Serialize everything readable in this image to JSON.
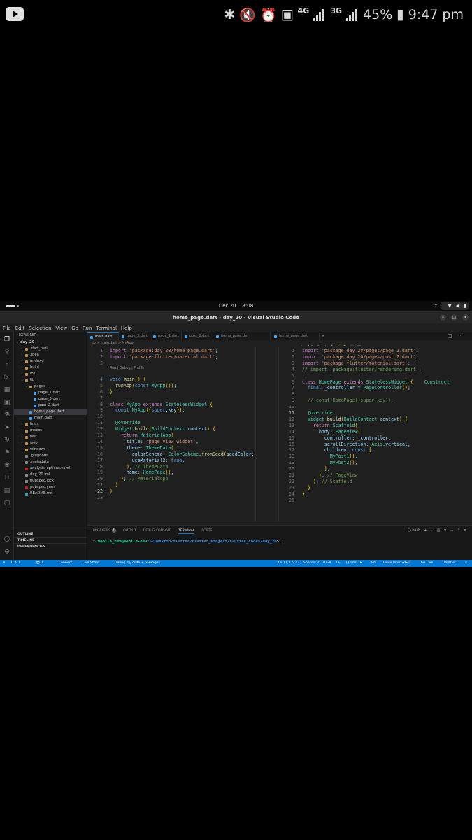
{
  "phone": {
    "battery": "45%",
    "time": "9:47 pm",
    "net1": "4G",
    "net2": "3G"
  },
  "topbar": {
    "date": "Dec 20",
    "time": "18:08"
  },
  "window": {
    "title": "home_page.dart - day_20 - Visual Studio Code"
  },
  "menu": [
    "File",
    "Edit",
    "Selection",
    "View",
    "Go",
    "Run",
    "Terminal",
    "Help"
  ],
  "explorer": {
    "header": "EXPLORER",
    "root": "day_20",
    "items": [
      {
        "label": ".dart_tool",
        "depth": 1,
        "type": "folder"
      },
      {
        "label": ".idea",
        "depth": 1,
        "type": "folder"
      },
      {
        "label": "android",
        "depth": 1,
        "type": "folder"
      },
      {
        "label": "build",
        "depth": 1,
        "type": "folder"
      },
      {
        "label": "ios",
        "depth": 1,
        "type": "folder"
      },
      {
        "label": "lib",
        "depth": 1,
        "type": "folder-open"
      },
      {
        "label": "pages",
        "depth": 2,
        "type": "folder-open"
      },
      {
        "label": "page_1.dart",
        "depth": 3,
        "type": "dart"
      },
      {
        "label": "page_3.dart",
        "depth": 3,
        "type": "dart"
      },
      {
        "label": "post_2.dart",
        "depth": 3,
        "type": "dart"
      },
      {
        "label": "home_page.dart",
        "depth": 2,
        "type": "dart",
        "selected": true
      },
      {
        "label": "main.dart",
        "depth": 2,
        "type": "dart"
      },
      {
        "label": "linux",
        "depth": 1,
        "type": "folder"
      },
      {
        "label": "macos",
        "depth": 1,
        "type": "folder"
      },
      {
        "label": "test",
        "depth": 1,
        "type": "folder"
      },
      {
        "label": "web",
        "depth": 1,
        "type": "folder"
      },
      {
        "label": "windows",
        "depth": 1,
        "type": "folder"
      },
      {
        "label": ".gitignore",
        "depth": 1,
        "type": "file"
      },
      {
        "label": ".metadata",
        "depth": 1,
        "type": "file"
      },
      {
        "label": "analysis_options.yaml",
        "depth": 1,
        "type": "yaml"
      },
      {
        "label": "day_20.iml",
        "depth": 1,
        "type": "file"
      },
      {
        "label": "pubspec.lock",
        "depth": 1,
        "type": "file"
      },
      {
        "label": "pubspec.yaml",
        "depth": 1,
        "type": "yaml"
      },
      {
        "label": "README.md",
        "depth": 1,
        "type": "md"
      }
    ],
    "sections": [
      "OUTLINE",
      "TIMELINE",
      "DEPENDENCIES"
    ]
  },
  "tabs": [
    {
      "label": "main.dart",
      "active": true
    },
    {
      "label": "page_3.dart",
      "active": false
    },
    {
      "label": "page_1.dart",
      "active": false
    },
    {
      "label": "post_2.dart",
      "active": false
    },
    {
      "label": "home_page.da",
      "active": false
    },
    {
      "label": "home_page.dart",
      "active": true
    }
  ],
  "breadcrumb_left": "lib > main.dart > MyApp",
  "breadcrumb_right": "",
  "left_editor": {
    "codelens": "Run | Debug | Profile",
    "lines": [
      "import 'package:day_20/home_page.dart';",
      "import 'package:flutter/material.dart';",
      "",
      "void main() {",
      "  runApp(const MyApp());",
      "}",
      "",
      "class MyApp extends StatelessWidget {",
      "  const MyApp({super.key});",
      "",
      "  @override",
      "  Widget build(BuildContext context) {",
      "    return MaterialApp(",
      "      title: 'page view widget',",
      "      theme: ThemeData(",
      "        colorScheme: ColorScheme.fromSeed(seedColor:",
      "        useMaterial3: true,",
      "      ), // ThemeData",
      "      home: HomePage(),",
      "    ); // MaterialApp",
      "  }",
      "}",
      ""
    ],
    "current_line": "22"
  },
  "right_editor": {
    "lines": [
      "import 'package:day_20/pages/page_1.dart';",
      "import 'package:day_20/pages/post_2.dart';",
      "import 'package:flutter/material.dart';",
      "// import 'package:flutter/rendering.dart';",
      "",
      "class HomePage extends StatelessWidget {    Construct",
      "  final _controller = PageController();",
      "",
      "  // const HomePage({super.key});",
      "",
      "  @override",
      "  Widget build(BuildContext context) {",
      "    return Scaffold(",
      "      body: PageView(",
      "        controller: _controller,",
      "        scrollDirection: Axis.vertical,",
      "        children: const [",
      "          MyPost1(),",
      "          MyPost2(),",
      "        ],",
      "      ), // PageView",
      "    ); // Scaffold",
      "  }",
      "}",
      ""
    ],
    "current_line": "11"
  },
  "panel": {
    "tabs": [
      "PROBLEMS",
      "OUTPUT",
      "DEBUG CONSOLE",
      "TERMINAL",
      "PORTS"
    ],
    "problems_count": "1",
    "terminal_shell": "bash",
    "prompt_user": "mobile_dev@mobile-dev",
    "prompt_path": ":~/Desktop/flutter/Flutter_Project/Flutter_codes/day_20",
    "prompt_end": "$ ||"
  },
  "status": {
    "errors": "0 ⚠ 1",
    "warnings": "⨂ 0",
    "connect": "Connect",
    "liveshare": "Live Share",
    "debug": "Debug my code + packages",
    "position": "Ln 11, Col 12",
    "spaces": "Spaces: 2",
    "encoding": "UTF-8",
    "eol": "LF",
    "lang": "{} Dart",
    "time": "8m",
    "device": "Linux (linux-x64)",
    "golive": "Go Live",
    "prettier": "Prettier"
  },
  "colors": {
    "accent": "#0078d4",
    "editor_bg": "#1f1f1f",
    "sidebar_bg": "#181818"
  }
}
